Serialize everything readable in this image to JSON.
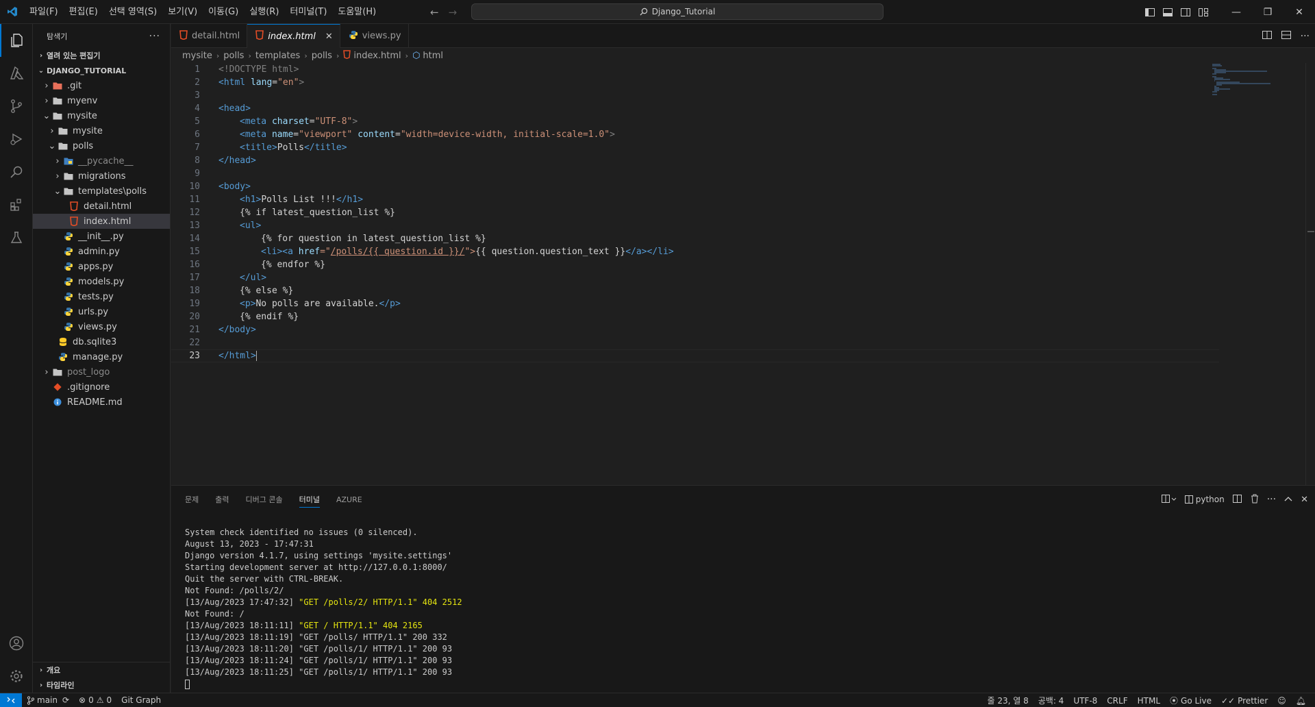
{
  "menubar": {
    "items": [
      "파일(F)",
      "편집(E)",
      "선택 영역(S)",
      "보기(V)",
      "이동(G)",
      "실행(R)",
      "터미널(T)",
      "도움말(H)"
    ]
  },
  "command_center": {
    "text": "Django_Tutorial",
    "icon": "search-icon"
  },
  "explorer": {
    "title": "탐색기",
    "open_editors": "열려 있는 편집기",
    "root": "DJANGO_TUTORIAL",
    "outline": "개요",
    "timeline": "타임라인",
    "tree": [
      {
        "label": ".git",
        "type": "folder-git",
        "expanded": false
      },
      {
        "label": "myenv",
        "type": "folder",
        "expanded": false
      },
      {
        "label": "mysite",
        "type": "folder",
        "expanded": true
      },
      {
        "label": "mysite",
        "type": "folder",
        "expanded": false
      },
      {
        "label": "polls",
        "type": "folder",
        "expanded": true
      },
      {
        "label": "__pycache__",
        "type": "folder-python",
        "expanded": false
      },
      {
        "label": "migrations",
        "type": "folder",
        "expanded": false
      },
      {
        "label": "templates\\polls",
        "type": "folder",
        "expanded": true
      },
      {
        "label": "detail.html",
        "type": "html"
      },
      {
        "label": "index.html",
        "type": "html"
      },
      {
        "label": "__init__.py",
        "type": "python"
      },
      {
        "label": "admin.py",
        "type": "python"
      },
      {
        "label": "apps.py",
        "type": "python"
      },
      {
        "label": "models.py",
        "type": "python"
      },
      {
        "label": "tests.py",
        "type": "python"
      },
      {
        "label": "urls.py",
        "type": "python"
      },
      {
        "label": "views.py",
        "type": "python"
      },
      {
        "label": "db.sqlite3",
        "type": "database"
      },
      {
        "label": "manage.py",
        "type": "python"
      },
      {
        "label": "post_logo",
        "type": "folder",
        "expanded": false
      },
      {
        "label": ".gitignore",
        "type": "git"
      },
      {
        "label": "README.md",
        "type": "info"
      }
    ]
  },
  "tabs": [
    {
      "label": "detail.html",
      "icon": "html-file-icon"
    },
    {
      "label": "index.html",
      "icon": "html-file-icon",
      "active": true
    },
    {
      "label": "views.py",
      "icon": "python-file-icon"
    }
  ],
  "breadcrumb": [
    "mysite",
    "polls",
    "templates",
    "polls",
    "index.html",
    "html"
  ],
  "code_lines": [
    "1",
    "2",
    "3",
    "4",
    "5",
    "6",
    "7",
    "8",
    "9",
    "10",
    "11",
    "12",
    "13",
    "14",
    "15",
    "16",
    "17",
    "18",
    "19",
    "20",
    "21",
    "22",
    "23"
  ],
  "code": {
    "l1_tag": "<!DOCTYPE html>",
    "l2_a": "<html ",
    "l2_attr": "lang",
    "l2_eq": "=",
    "l2_val": "\"en\"",
    "l2_b": ">",
    "l4": "<head>",
    "l5_a": "<meta ",
    "l5_attr": "charset",
    "l5_eq": "=",
    "l5_val": "\"UTF-8\"",
    "l5_b": ">",
    "l6_a": "<meta ",
    "l6_attr1": "name",
    "l6_eq1": "=",
    "l6_val1": "\"viewport\"",
    "l6_sp": " ",
    "l6_attr2": "content",
    "l6_eq2": "=",
    "l6_val2": "\"width=device-width, initial-scale=1.0\"",
    "l6_b": ">",
    "l7_a": "<title>",
    "l7_t": "Polls",
    "l7_b": "</title>",
    "l8": "</head>",
    "l10": "<body>",
    "l11_a": "<h1>",
    "l11_t": "Polls List !!!",
    "l11_b": "</h1>",
    "l12": "{% if latest_question_list %}",
    "l13": "<ul>",
    "l14": "{% for question in latest_question_list %}",
    "l15_a": "<li><a ",
    "l15_attr": "href",
    "l15_eq": "=\"",
    "l15_url": "/polls/{{ question.id }}/",
    "l15_q": "\">",
    "l15_t": "{{ question.question_text }}",
    "l15_b": "</a></li>",
    "l16": "{% endfor %}",
    "l17": "</ul>",
    "l18": "{% else %}",
    "l19_a": "<p>",
    "l19_t": "No polls are available.",
    "l19_b": "</p>",
    "l20": "{% endif %}",
    "l21": "</body>",
    "l23": "</html>"
  },
  "panel": {
    "tabs": [
      "문제",
      "출력",
      "디버그 콘솔",
      "터미널",
      "AZURE"
    ],
    "active_tab": "터미널",
    "terminal_name": "python",
    "terminal_lines": [
      "System check identified no issues (0 silenced).",
      "August 13, 2023 - 17:47:31",
      "Django version 4.1.7, using settings 'mysite.settings'",
      "Starting development server at http://127.0.0.1:8000/",
      "Quit the server with CTRL-BREAK.",
      "Not Found: /polls/2/",
      "[13/Aug/2023 17:47:32] ",
      "Not Found: /",
      "[13/Aug/2023 18:11:11] ",
      "[13/Aug/2023 18:11:19] \"GET /polls/ HTTP/1.1\" 200 332",
      "[13/Aug/2023 18:11:20] \"GET /polls/1/ HTTP/1.1\" 200 93",
      "[13/Aug/2023 18:11:24] \"GET /polls/1/ HTTP/1.1\" 200 93",
      "[13/Aug/2023 18:11:25] \"GET /polls/1/ HTTP/1.1\" 200 93"
    ],
    "hl1": "\"GET /polls/2/ HTTP/1.1\" 404 2512",
    "hl2": "\"GET / HTTP/1.1\" 404 2165"
  },
  "statusbar": {
    "branch": "main",
    "errors": "0",
    "warnings": "0",
    "git_graph": "Git Graph",
    "position": "줄 23, 열 8",
    "spaces": "공백: 4",
    "encoding": "UTF-8",
    "eol": "CRLF",
    "language": "HTML",
    "golive": "Go Live",
    "prettier": "Prettier"
  },
  "colors": {
    "accent": "#0078d4",
    "html_icon": "#e44d26",
    "python_blue": "#3572a5",
    "python_yellow": "#ffd43b",
    "terminal_highlight": "#e5e510"
  }
}
